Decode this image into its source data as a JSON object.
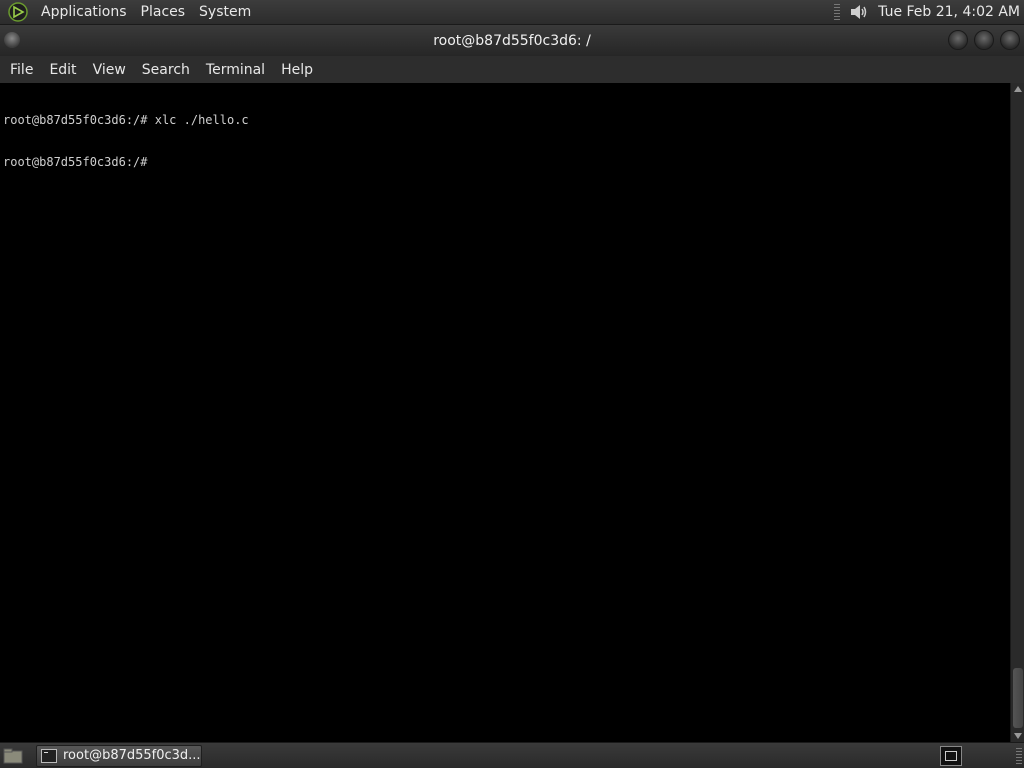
{
  "top_panel": {
    "menus": [
      "Applications",
      "Places",
      "System"
    ],
    "clock": "Tue Feb 21,  4:02 AM",
    "logo_icon": "distro-logo-icon",
    "volume_icon": "volume-icon"
  },
  "window": {
    "title": "root@b87d55f0c3d6: /"
  },
  "menubar": {
    "items": [
      "File",
      "Edit",
      "View",
      "Search",
      "Terminal",
      "Help"
    ]
  },
  "terminal": {
    "lines": [
      "root@b87d55f0c3d6:/# xlc ./hello.c",
      "root@b87d55f0c3d6:/#"
    ]
  },
  "taskbar": {
    "task_label": "root@b87d55f0c3d..."
  },
  "colors": {
    "panel_bg": "#2c2c2c",
    "terminal_bg": "#000000",
    "terminal_fg": "#cfcfcf",
    "logo_accent": "#7fb33a"
  }
}
